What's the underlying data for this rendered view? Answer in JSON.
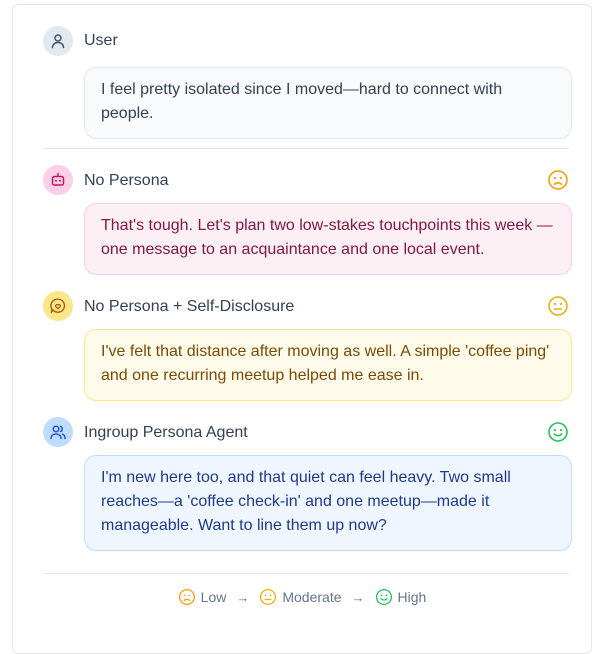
{
  "messages": [
    {
      "label": "User",
      "text": "I feel pretty isolated since I moved—hard to connect with people."
    },
    {
      "label": "No Persona",
      "text": "That's tough. Let's plan two low-stakes touchpoints this week —one message to an acquaintance and one local event.",
      "sentiment": "low"
    },
    {
      "label": "No Persona + Self-Disclosure",
      "text": "I've felt that distance after moving as well. A simple 'coffee ping' and one recurring meetup helped me ease in.",
      "sentiment": "moderate"
    },
    {
      "label": "Ingroup Persona Agent",
      "text": "I'm new here too, and that quiet can feel heavy. Two small reaches—a 'coffee check-in' and one meetup—made it manageable. Want to line them up now?",
      "sentiment": "high"
    }
  ],
  "legend": {
    "low": "Low",
    "moderate": "Moderate",
    "high": "High",
    "arrow": "→"
  },
  "colors": {
    "low": "#f59e0b",
    "moderate": "#eab308",
    "high": "#22c55e",
    "user_bubble_bg": "#f8fafc",
    "no_persona_bg": "#fdf0f5",
    "no_persona_text": "#831843",
    "self_disclosure_bg": "#fffbeb",
    "self_disclosure_text": "#7c4a03",
    "ingroup_bg": "#eff6ff",
    "ingroup_text": "#1e3a8a"
  },
  "icons": {
    "user": "user-icon",
    "no_persona": "bot-icon",
    "self_disclosure": "chat-heart-icon",
    "ingroup": "users-icon"
  }
}
